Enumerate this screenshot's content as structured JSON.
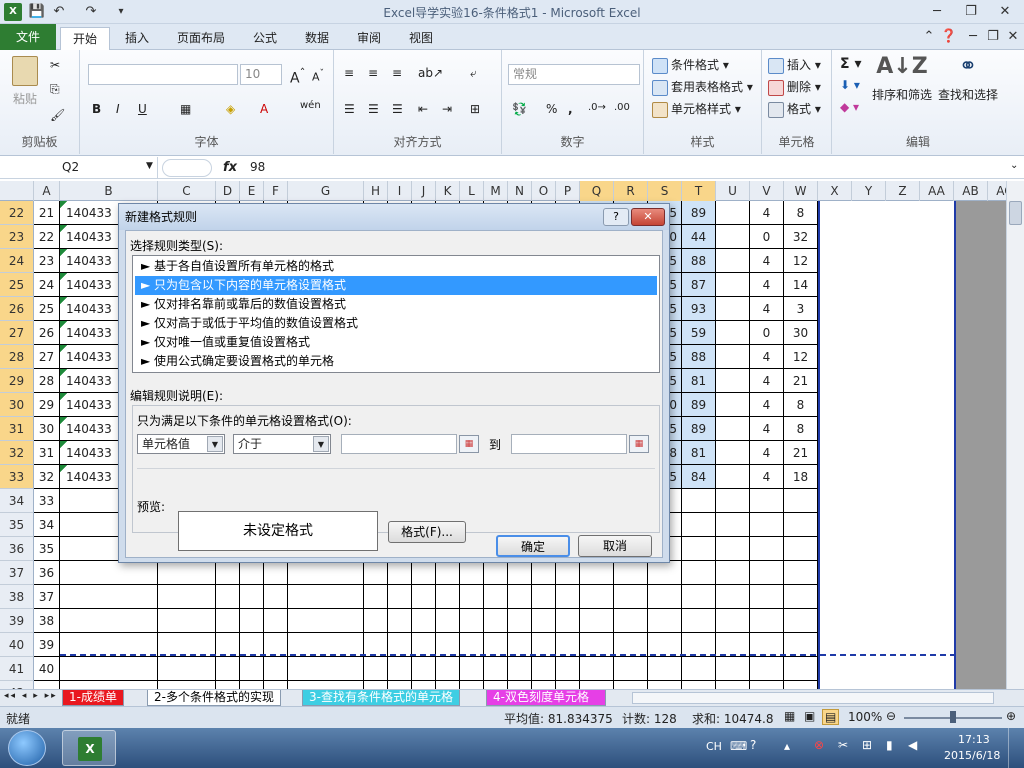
{
  "titlebar": {
    "title": "Excel导学实验16-条件格式1  -  Microsoft Excel"
  },
  "tabs": {
    "file": "文件",
    "items": [
      "开始",
      "插入",
      "页面布局",
      "公式",
      "数据",
      "审阅",
      "视图"
    ]
  },
  "ribbon": {
    "clipboard": {
      "label": "剪贴板",
      "paste": "粘贴"
    },
    "font": {
      "label": "字体",
      "size": "10"
    },
    "align": {
      "label": "对齐方式"
    },
    "number": {
      "label": "数字",
      "format": "常规"
    },
    "styles": {
      "label": "样式",
      "conditional": "条件格式",
      "table": "套用表格格式",
      "cell": "单元格样式"
    },
    "cells": {
      "label": "单元格",
      "insert": "插入",
      "delete": "删除",
      "format": "格式"
    },
    "edit": {
      "label": "编辑",
      "sort": "排序和筛选",
      "find": "查找和选择"
    }
  },
  "formula": {
    "namebox": "Q2",
    "fx": "fx",
    "value": "98"
  },
  "columns": [
    "A",
    "B",
    "C",
    "D",
    "E",
    "F",
    "G",
    "H",
    "I",
    "J",
    "K",
    "L",
    "M",
    "N",
    "O",
    "P",
    "Q",
    "R",
    "S",
    "T",
    "U",
    "V",
    "W",
    "X",
    "Y",
    "Z",
    "AA",
    "AB",
    "AC"
  ],
  "rows": [
    {
      "n": "22",
      "a": "21",
      "b": "140433",
      "s": "5",
      "t": "89",
      "v": "4",
      "w": "8"
    },
    {
      "n": "23",
      "a": "22",
      "b": "140433",
      "s": "0",
      "t": "44",
      "v": "0",
      "w": "32"
    },
    {
      "n": "24",
      "a": "23",
      "b": "140433",
      "s": "5",
      "t": "88",
      "v": "4",
      "w": "12"
    },
    {
      "n": "25",
      "a": "24",
      "b": "140433",
      "s": "5",
      "t": "87",
      "v": "4",
      "w": "14"
    },
    {
      "n": "26",
      "a": "25",
      "b": "140433",
      "s": "5",
      "t": "93",
      "v": "4",
      "w": "3"
    },
    {
      "n": "27",
      "a": "26",
      "b": "140433",
      "s": "5",
      "t": "59",
      "v": "0",
      "w": "30"
    },
    {
      "n": "28",
      "a": "27",
      "b": "140433",
      "s": "5",
      "t": "88",
      "v": "4",
      "w": "12"
    },
    {
      "n": "29",
      "a": "28",
      "b": "140433",
      "s": "5",
      "t": "81",
      "v": "4",
      "w": "21"
    },
    {
      "n": "30",
      "a": "29",
      "b": "140433",
      "s": "0",
      "t": "89",
      "v": "4",
      "w": "8"
    },
    {
      "n": "31",
      "a": "30",
      "b": "140433",
      "s": "5",
      "t": "89",
      "v": "4",
      "w": "8"
    },
    {
      "n": "32",
      "a": "31",
      "b": "140433",
      "s": "8",
      "t": "81",
      "v": "4",
      "w": "21"
    },
    {
      "n": "33",
      "a": "32",
      "b": "140433",
      "s": "5",
      "t": "84",
      "v": "4",
      "w": "18"
    },
    {
      "n": "34",
      "a": "33",
      "b": "",
      "s": "",
      "t": "",
      "v": "",
      "w": ""
    },
    {
      "n": "35",
      "a": "34",
      "b": "",
      "s": "",
      "t": "",
      "v": "",
      "w": ""
    },
    {
      "n": "36",
      "a": "35",
      "b": "",
      "s": "",
      "t": "",
      "v": "",
      "w": ""
    },
    {
      "n": "37",
      "a": "36",
      "b": "",
      "s": "",
      "t": "",
      "v": "",
      "w": ""
    },
    {
      "n": "38",
      "a": "37",
      "b": "",
      "s": "",
      "t": "",
      "v": "",
      "w": ""
    },
    {
      "n": "39",
      "a": "38",
      "b": "",
      "s": "",
      "t": "",
      "v": "",
      "w": ""
    },
    {
      "n": "40",
      "a": "39",
      "b": "",
      "s": "",
      "t": "",
      "v": "",
      "w": ""
    },
    {
      "n": "41",
      "a": "40",
      "b": "",
      "s": "",
      "t": "",
      "v": "",
      "w": ""
    },
    {
      "n": "42",
      "a": "",
      "b": "",
      "s": "",
      "t": "",
      "v": "",
      "w": ""
    }
  ],
  "sheets": [
    "1-成绩单",
    "2-多个条件格式的实现",
    "3-查找有条件格式的单元格",
    "4-双色刻度单元格"
  ],
  "status": {
    "ready": "就绪",
    "avg": "平均值: 81.834375",
    "count": "计数: 128",
    "sum": "求和: 10474.8",
    "zoom": "100%"
  },
  "taskbar": {
    "lang": "CH",
    "time": "17:13",
    "date": "2015/6/18"
  },
  "dialog": {
    "title": "新建格式规则",
    "select_label": "选择规则类型(S):",
    "rules": [
      "► 基于各自值设置所有单元格的格式",
      "► 只为包含以下内容的单元格设置格式",
      "► 仅对排名靠前或靠后的数值设置格式",
      "► 仅对高于或低于平均值的数值设置格式",
      "► 仅对唯一值或重复值设置格式",
      "► 使用公式确定要设置格式的单元格"
    ],
    "edit_label": "编辑规则说明(E):",
    "condition_label": "只为满足以下条件的单元格设置格式(O):",
    "sel1": "单元格值",
    "sel2": "介于",
    "to": "到",
    "preview_label": "预览:",
    "preview_text": "未设定格式",
    "format_btn": "格式(F)...",
    "ok": "确定",
    "cancel": "取消"
  }
}
